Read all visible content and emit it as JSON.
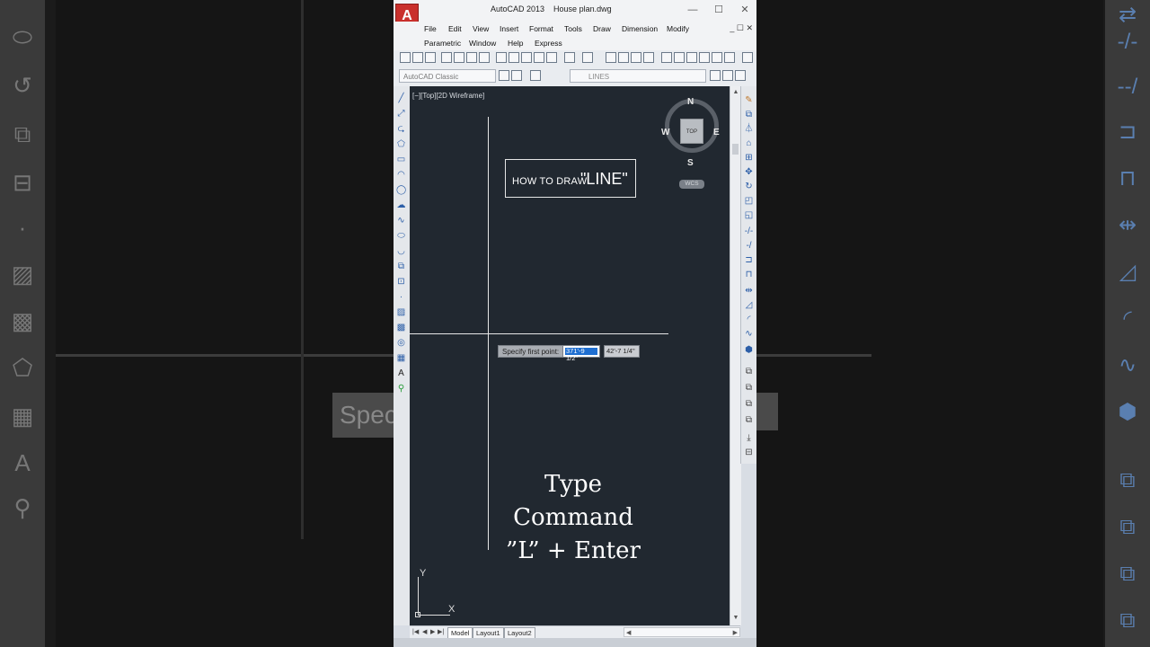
{
  "window": {
    "app_name": "AutoCAD 2013",
    "file_name": "House plan.dwg",
    "logo_letter": "A",
    "minimize": "—",
    "maximize": "☐",
    "close": "✕",
    "mdi_controls": "_ ☐ ✕"
  },
  "menu": {
    "row1": [
      "File",
      "Edit",
      "View",
      "Insert",
      "Format",
      "Tools",
      "Draw",
      "Dimension",
      "Modify"
    ],
    "row2": [
      "Parametric",
      "Window",
      "Help",
      "Express"
    ]
  },
  "toolbar": {
    "workspace": "AutoCAD Classic",
    "layer": "LINES"
  },
  "viewport": {
    "label": "[−][Top][2D Wireframe]"
  },
  "annotation_box": {
    "small": "HOW TO DRAW",
    "big": "\"LINE\""
  },
  "command_prompt": {
    "label": "Specify first point:",
    "coord1": "371'-9 1/2\"",
    "coord2": "42'-7 1/4\""
  },
  "caption": {
    "line1": "Type Command",
    "line2": "”L” + Enter"
  },
  "viewcube": {
    "n": "N",
    "s": "S",
    "e": "E",
    "w": "W",
    "top": "TOP",
    "wcs": "WCS"
  },
  "ucs": {
    "x": "X",
    "y": "Y"
  },
  "tabs": [
    "Model",
    "Layout1",
    "Layout2"
  ],
  "background": {
    "left_tooltip": "Speci"
  },
  "colors": {
    "drawing_bg": "#212830",
    "highlight": "#1f6fd1",
    "logo_red": "#c9302c"
  }
}
